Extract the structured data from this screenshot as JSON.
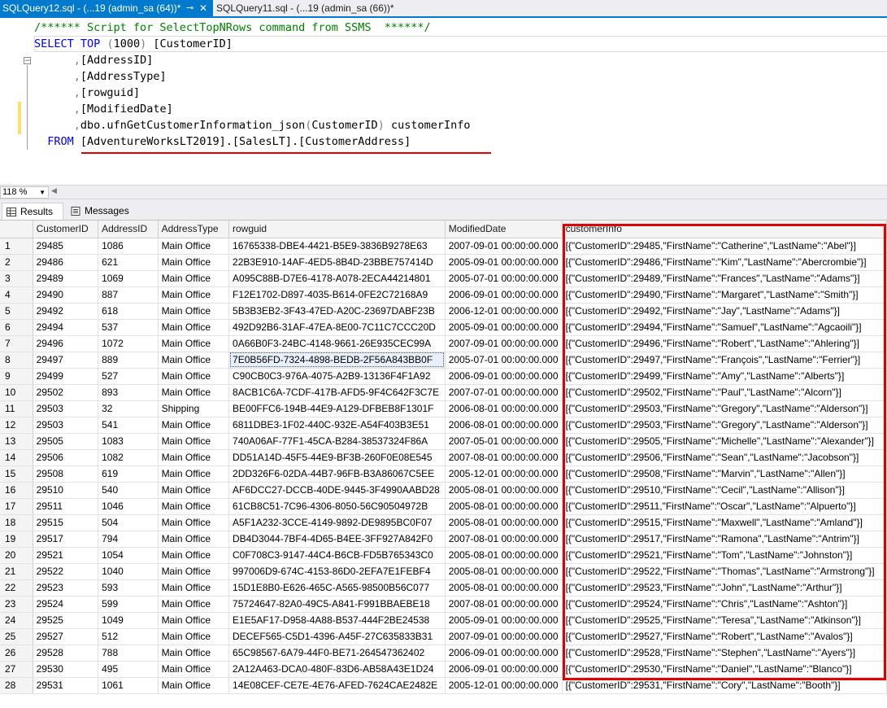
{
  "tabs": [
    {
      "label": "SQLQuery12.sql - (...19 (admin_sa (64))*",
      "active": true
    },
    {
      "label": "SQLQuery11.sql - (...19 (admin_sa (66))*",
      "active": false
    }
  ],
  "editor": {
    "line1": "/****** Script for SelectTopNRows command from SSMS  ******/",
    "line2_kw1": "SELECT",
    "line2_kw2": "TOP",
    "line2_num": "(1000)",
    "line2_col": "[CustomerID]",
    "columns": [
      "[AddressID]",
      "[AddressType]",
      "[rowguid]",
      "[ModifiedDate]"
    ],
    "fn_call": "dbo.ufnGetCustomerInformation_json",
    "fn_arg": "(CustomerID)",
    "fn_alias": "customerInfo",
    "from_kw": "FROM",
    "from_table": "[AdventureWorksLT2019].[SalesLT].[CustomerAddress]"
  },
  "zoom": "118 %",
  "result_tabs": {
    "results": "Results",
    "messages": "Messages"
  },
  "grid": {
    "columns": [
      "CustomerID",
      "AddressID",
      "AddressType",
      "rowguid",
      "ModifiedDate",
      "customerInfo"
    ],
    "rows": [
      [
        "1",
        "29485",
        "1086",
        "Main Office",
        "16765338-DBE4-4421-B5E9-3836B9278E63",
        "2007-09-01 00:00:00.000",
        "[{\"CustomerID\":29485,\"FirstName\":\"Catherine\",\"LastName\":\"Abel\"}]"
      ],
      [
        "2",
        "29486",
        "621",
        "Main Office",
        "22B3E910-14AF-4ED5-8B4D-23BBE757414D",
        "2005-09-01 00:00:00.000",
        "[{\"CustomerID\":29486,\"FirstName\":\"Kim\",\"LastName\":\"Abercrombie\"}]"
      ],
      [
        "3",
        "29489",
        "1069",
        "Main Office",
        "A095C88B-D7E6-4178-A078-2ECA44214801",
        "2005-07-01 00:00:00.000",
        "[{\"CustomerID\":29489,\"FirstName\":\"Frances\",\"LastName\":\"Adams\"}]"
      ],
      [
        "4",
        "29490",
        "887",
        "Main Office",
        "F12E1702-D897-4035-B614-0FE2C72168A9",
        "2006-09-01 00:00:00.000",
        "[{\"CustomerID\":29490,\"FirstName\":\"Margaret\",\"LastName\":\"Smith\"}]"
      ],
      [
        "5",
        "29492",
        "618",
        "Main Office",
        "5B3B3EB2-3F43-47ED-A20C-23697DABF23B",
        "2006-12-01 00:00:00.000",
        "[{\"CustomerID\":29492,\"FirstName\":\"Jay\",\"LastName\":\"Adams\"}]"
      ],
      [
        "6",
        "29494",
        "537",
        "Main Office",
        "492D92B6-31AF-47EA-8E00-7C11C7CCC20D",
        "2005-09-01 00:00:00.000",
        "[{\"CustomerID\":29494,\"FirstName\":\"Samuel\",\"LastName\":\"Agcaoili\"}]"
      ],
      [
        "7",
        "29496",
        "1072",
        "Main Office",
        "0A66B0F3-24BC-4148-9661-26E935CEC99A",
        "2007-09-01 00:00:00.000",
        "[{\"CustomerID\":29496,\"FirstName\":\"Robert\",\"LastName\":\"Ahlering\"}]"
      ],
      [
        "8",
        "29497",
        "889",
        "Main Office",
        "7E0B56FD-7324-4898-BEDB-2F56A843BB0F",
        "2005-07-01 00:00:00.000",
        "[{\"CustomerID\":29497,\"FirstName\":\"François\",\"LastName\":\"Ferrier\"}]"
      ],
      [
        "9",
        "29499",
        "527",
        "Main Office",
        "C90CB0C3-976A-4075-A2B9-13136F4F1A92",
        "2006-09-01 00:00:00.000",
        "[{\"CustomerID\":29499,\"FirstName\":\"Amy\",\"LastName\":\"Alberts\"}]"
      ],
      [
        "10",
        "29502",
        "893",
        "Main Office",
        "8ACB1C6A-7CDF-417B-AFD5-9F4C642F3C7E",
        "2007-07-01 00:00:00.000",
        "[{\"CustomerID\":29502,\"FirstName\":\"Paul\",\"LastName\":\"Alcorn\"}]"
      ],
      [
        "11",
        "29503",
        "32",
        "Shipping",
        "BE00FFC6-194B-44E9-A129-DFBEB8F1301F",
        "2006-08-01 00:00:00.000",
        "[{\"CustomerID\":29503,\"FirstName\":\"Gregory\",\"LastName\":\"Alderson\"}]"
      ],
      [
        "12",
        "29503",
        "541",
        "Main Office",
        "6811DBE3-1F02-440C-932E-A54F403B3E51",
        "2006-08-01 00:00:00.000",
        "[{\"CustomerID\":29503,\"FirstName\":\"Gregory\",\"LastName\":\"Alderson\"}]"
      ],
      [
        "13",
        "29505",
        "1083",
        "Main Office",
        "740A06AF-77F1-45CA-B284-38537324F86A",
        "2007-05-01 00:00:00.000",
        "[{\"CustomerID\":29505,\"FirstName\":\"Michelle\",\"LastName\":\"Alexander\"}]"
      ],
      [
        "14",
        "29506",
        "1082",
        "Main Office",
        "DD51A14D-45F5-44E9-BF3B-260F0E08E545",
        "2007-08-01 00:00:00.000",
        "[{\"CustomerID\":29506,\"FirstName\":\"Sean\",\"LastName\":\"Jacobson\"}]"
      ],
      [
        "15",
        "29508",
        "619",
        "Main Office",
        "2DD326F6-02DA-44B7-96FB-B3A86067C5EE",
        "2005-12-01 00:00:00.000",
        "[{\"CustomerID\":29508,\"FirstName\":\"Marvin\",\"LastName\":\"Allen\"}]"
      ],
      [
        "16",
        "29510",
        "540",
        "Main Office",
        "AF6DCC27-DCCB-40DE-9445-3F4990AABD28",
        "2005-08-01 00:00:00.000",
        "[{\"CustomerID\":29510,\"FirstName\":\"Cecil\",\"LastName\":\"Allison\"}]"
      ],
      [
        "17",
        "29511",
        "1046",
        "Main Office",
        "61CB8C51-7C96-4306-8050-56C90504972B",
        "2005-08-01 00:00:00.000",
        "[{\"CustomerID\":29511,\"FirstName\":\"Oscar\",\"LastName\":\"Alpuerto\"}]"
      ],
      [
        "18",
        "29515",
        "504",
        "Main Office",
        "A5F1A232-3CCE-4149-9892-DE9895BC0F07",
        "2005-08-01 00:00:00.000",
        "[{\"CustomerID\":29515,\"FirstName\":\"Maxwell\",\"LastName\":\"Amland\"}]"
      ],
      [
        "19",
        "29517",
        "794",
        "Main Office",
        "DB4D3044-7BF4-4D65-B4EE-3FF927A842F0",
        "2007-08-01 00:00:00.000",
        "[{\"CustomerID\":29517,\"FirstName\":\"Ramona\",\"LastName\":\"Antrim\"}]"
      ],
      [
        "20",
        "29521",
        "1054",
        "Main Office",
        "C0F708C3-9147-44C4-B6CB-FD5B765343C0",
        "2005-08-01 00:00:00.000",
        "[{\"CustomerID\":29521,\"FirstName\":\"Tom\",\"LastName\":\"Johnston\"}]"
      ],
      [
        "21",
        "29522",
        "1040",
        "Main Office",
        "997006D9-674C-4153-86D0-2EFA7E1FEBF4",
        "2005-08-01 00:00:00.000",
        "[{\"CustomerID\":29522,\"FirstName\":\"Thomas\",\"LastName\":\"Armstrong\"}]"
      ],
      [
        "22",
        "29523",
        "593",
        "Main Office",
        "15D1E8B0-E626-465C-A565-98500B56C077",
        "2005-08-01 00:00:00.000",
        "[{\"CustomerID\":29523,\"FirstName\":\"John\",\"LastName\":\"Arthur\"}]"
      ],
      [
        "23",
        "29524",
        "599",
        "Main Office",
        "75724647-82A0-49C5-A841-F991BBAEBE18",
        "2007-08-01 00:00:00.000",
        "[{\"CustomerID\":29524,\"FirstName\":\"Chris\",\"LastName\":\"Ashton\"}]"
      ],
      [
        "24",
        "29525",
        "1049",
        "Main Office",
        "E1E5AF17-D958-4A88-B537-444F2BE24538",
        "2005-09-01 00:00:00.000",
        "[{\"CustomerID\":29525,\"FirstName\":\"Teresa\",\"LastName\":\"Atkinson\"}]"
      ],
      [
        "25",
        "29527",
        "512",
        "Main Office",
        "DECEF565-C5D1-4396-A45F-27C635833B31",
        "2007-09-01 00:00:00.000",
        "[{\"CustomerID\":29527,\"FirstName\":\"Robert\",\"LastName\":\"Avalos\"}]"
      ],
      [
        "26",
        "29528",
        "788",
        "Main Office",
        "65C98567-6A79-44F0-BE71-264547362402",
        "2006-09-01 00:00:00.000",
        "[{\"CustomerID\":29528,\"FirstName\":\"Stephen\",\"LastName\":\"Ayers\"}]"
      ],
      [
        "27",
        "29530",
        "495",
        "Main Office",
        "2A12A463-DCA0-480F-83D6-AB58A43E1D24",
        "2006-09-01 00:00:00.000",
        "[{\"CustomerID\":29530,\"FirstName\":\"Daniel\",\"LastName\":\"Blanco\"}]"
      ],
      [
        "28",
        "29531",
        "1061",
        "Main Office",
        "14E08CEF-CE7E-4E76-AFED-7624CAE2482E",
        "2005-12-01 00:00:00.000",
        "[{\"CustomerID\":29531,\"FirstName\":\"Cory\",\"LastName\":\"Booth\"}]"
      ]
    ]
  }
}
